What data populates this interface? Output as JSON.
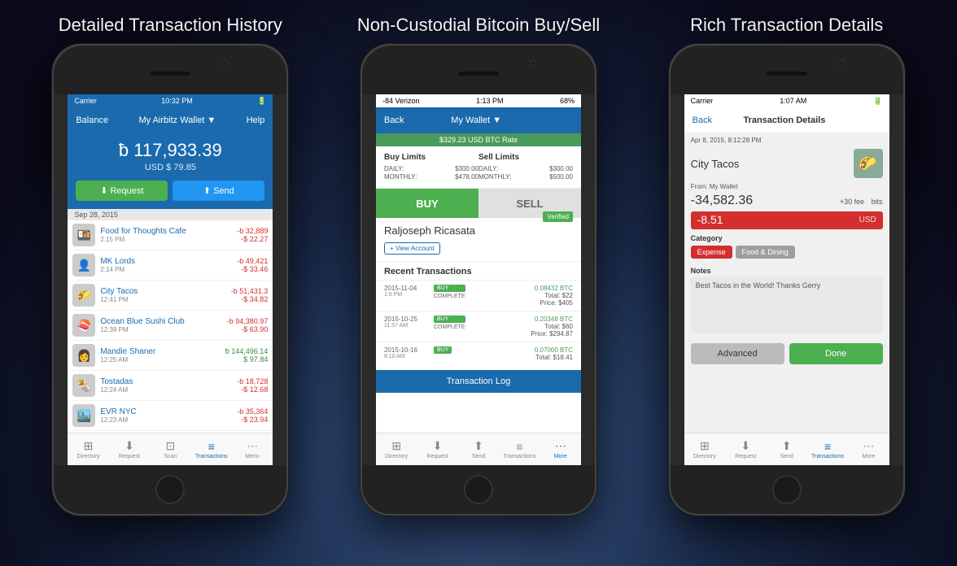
{
  "page": {
    "background": "#0a0a1a"
  },
  "headers": {
    "title1": "Detailed Transaction History",
    "title2": "Non-Custodial Bitcoin Buy/Sell",
    "title3": "Rich Transaction Details"
  },
  "phone1": {
    "status": {
      "carrier": "Carrier",
      "time": "10:32 PM",
      "battery": "■■■"
    },
    "nav": {
      "balance": "Balance",
      "wallet": "My Airbitz Wallet ▼",
      "help": "Help"
    },
    "amount": {
      "btc": "ƀ 117,933.39",
      "usd": "USD $ 79.85"
    },
    "actions": {
      "request": "Request",
      "send": "Send"
    },
    "date_header": "Sep 28, 2015",
    "transactions": [
      {
        "name": "Food for Thoughts Cafe",
        "time": "2:15 PM",
        "btc": "-b 32,889",
        "usd": "-$ 22.27",
        "icon": "🍱",
        "positive": false
      },
      {
        "name": "MK Lords",
        "time": "2:14 PM",
        "btc": "-b 49,421",
        "usd": "-$ 33.46",
        "icon": "👤",
        "positive": false
      },
      {
        "name": "City Tacos",
        "time": "12:41 PM",
        "btc": "-b 51,431.3",
        "usd": "-$ 34.82",
        "icon": "🌮",
        "positive": false
      },
      {
        "name": "Ocean Blue Sushi Club",
        "time": "12:39 PM",
        "btc": "-b 94,380.97",
        "usd": "-$ 63.90",
        "icon": "🍣",
        "positive": false
      },
      {
        "name": "Mandie Shaner",
        "time": "12:25 AM",
        "btc": "ƀ 144,496.14",
        "usd": "$ 97.84",
        "icon": "👩",
        "positive": true
      },
      {
        "name": "Tostadas",
        "time": "12:24 AM",
        "btc": "-b 18,728",
        "usd": "-$ 12.68",
        "icon": "🌯",
        "positive": false
      },
      {
        "name": "EVR NYC",
        "time": "12:23 AM",
        "btc": "-b 35,364",
        "usd": "-$ 23.94",
        "icon": "🏙️",
        "positive": false
      }
    ],
    "tabs": [
      {
        "label": "Directory",
        "icon": "⊞",
        "active": false
      },
      {
        "label": "Request",
        "icon": "↓",
        "active": false
      },
      {
        "label": "Scan",
        "icon": "⊡",
        "active": false
      },
      {
        "label": "Transactions",
        "icon": "≡",
        "active": true
      },
      {
        "label": "Menu",
        "icon": "⋯",
        "active": false
      }
    ]
  },
  "phone2": {
    "status": {
      "carrier": "-84 Verizon",
      "time": "1:13 PM",
      "battery": "68%"
    },
    "nav": {
      "back": "Back",
      "wallet": "My Wallet ▼"
    },
    "green_header": "$329.23 USD    BTC Rate",
    "limits": {
      "buy_title": "Buy Limits",
      "sell_title": "Sell Limits",
      "daily_label": "DAILY:",
      "monthly_label": "MONTHLY:",
      "buy_daily": "$300.00",
      "buy_monthly": "$478.00",
      "sell_daily": "$300.00",
      "sell_monthly": "$500.00"
    },
    "buy_label": "BUY",
    "sell_label": "SELL",
    "user": {
      "name": "Raljoseph Ricasata",
      "view_account": "+ View Account",
      "verified": "Verified"
    },
    "recent_title": "Recent Transactions",
    "transactions": [
      {
        "date": "2015-11-04",
        "time": "1:6 PM",
        "badge": "BUY",
        "status": "COMPLETE",
        "btc": "0.08432 BTC",
        "total": "Total: $22",
        "price": "Price: $405"
      },
      {
        "date": "2015-10-25",
        "time": "11:57 AM",
        "badge": "BUY",
        "status": "COMPLETE",
        "btc": "0.20348 BTC",
        "total": "Total: $60",
        "price": "Price: $294.87"
      },
      {
        "date": "2015-10-16",
        "time": "8:10 AM",
        "badge": "BUY",
        "status": "",
        "btc": "0.07000 BTC",
        "total": "Total: $18.41",
        "price": ""
      }
    ],
    "log_button": "Transaction Log",
    "tabs": [
      {
        "label": "Directory",
        "icon": "⊞",
        "active": false
      },
      {
        "label": "Request",
        "icon": "↓",
        "active": false
      },
      {
        "label": "Send",
        "icon": "↑",
        "active": false
      },
      {
        "label": "Transactions",
        "icon": "≡",
        "active": false
      },
      {
        "label": "More",
        "icon": "⋯",
        "active": true
      }
    ]
  },
  "phone3": {
    "status": {
      "carrier": "Carrier",
      "time": "1:07 AM",
      "battery": "■■■■"
    },
    "nav": {
      "back": "Back",
      "title": "Transaction Details"
    },
    "date": "Apr 8, 2015, 8:12:28 PM",
    "merchant": {
      "name": "City Tacos",
      "icon": "🌮"
    },
    "from": "From: My Wallet",
    "btc_amount": "-34,582.36",
    "fee": "+30 fee",
    "bits_label": "bits",
    "usd_amount": "-8.51",
    "usd_label": "USD",
    "category_label": "Category",
    "tags": {
      "expense": "Expense",
      "food": "Food & Dining"
    },
    "notes_label": "Notes",
    "notes": "Best Tacos in the World!  Thanks Gerry",
    "buttons": {
      "advanced": "Advanced",
      "done": "Done"
    },
    "tabs": [
      {
        "label": "Directory",
        "icon": "⊞",
        "active": false
      },
      {
        "label": "Request",
        "icon": "↓",
        "active": false
      },
      {
        "label": "Send",
        "icon": "↑",
        "active": false
      },
      {
        "label": "Transactions",
        "icon": "≡",
        "active": true
      },
      {
        "label": "More",
        "icon": "⋯",
        "active": false
      }
    ]
  }
}
